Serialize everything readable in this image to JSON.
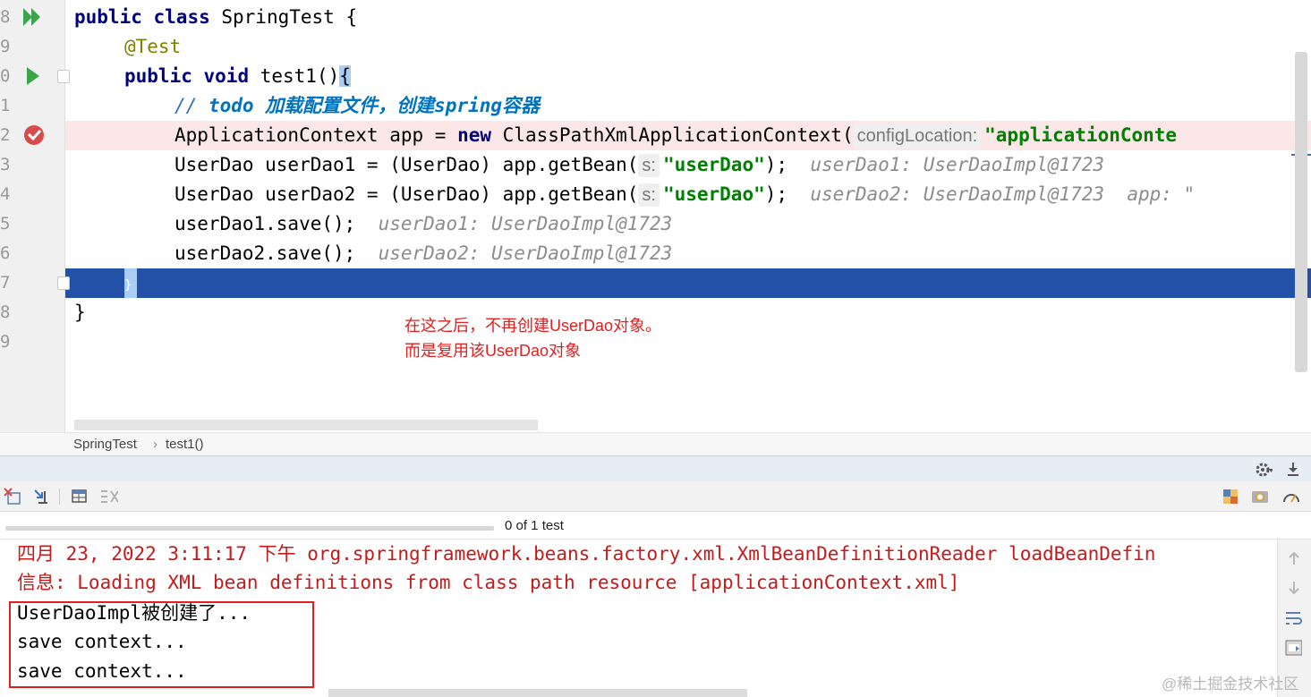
{
  "editor": {
    "line_numbers": [
      "8",
      "9",
      "0",
      "1",
      "2",
      "3",
      "4",
      "5",
      "6",
      "7",
      "8",
      "9"
    ],
    "lines": {
      "l8": {
        "kw1": "public",
        "kw2": "class",
        "rest": " SpringTest {"
      },
      "l9": {
        "annotation": "@Test"
      },
      "l10": {
        "kw1": "public",
        "kw2": "void",
        "rest": " test1()",
        "brace": "{"
      },
      "l11": {
        "comment": "// ",
        "todo": "todo 加载配置文件，创建spring容器"
      },
      "l12": {
        "code": "ApplicationContext app = ",
        "kw": "new",
        "code2": " ClassPathXmlApplicationContext(",
        "hint": "configLocation:",
        "str": "\"applicationConte"
      },
      "l13": {
        "code": "UserDao userDao1 = (UserDao) app.getBean(",
        "hint": "s:",
        "str": "\"userDao\"",
        "code2": ");",
        "inline": "  userDao1: UserDaoImpl@1723"
      },
      "l14": {
        "code": "UserDao userDao2 = (UserDao) app.getBean(",
        "hint": "s:",
        "str": "\"userDao\"",
        "code2": ");",
        "inline": "  userDao2: UserDaoImpl@1723  app: \""
      },
      "l15": {
        "code": "userDao1.save();",
        "inline": "  userDao1: UserDaoImpl@1723"
      },
      "l16": {
        "code": "userDao2.save();",
        "inline": "  userDao2: UserDaoImpl@1723"
      },
      "l17": {
        "brace": "}"
      },
      "l18": {
        "code": "}"
      }
    },
    "annotation": {
      "line1": "在这之后，不再创建UserDao对象。",
      "line2": "而是复用该UserDao对象"
    }
  },
  "breadcrumb": {
    "class": "SpringTest",
    "separator": "›",
    "method": "test1()"
  },
  "run_panel": {
    "test_count": "0 of 1 test",
    "progress": 0,
    "console_lines": [
      "四月 23, 2022 3:11:17 下午 org.springframework.beans.factory.xml.XmlBeanDefinitionReader loadBeanDefin",
      "信息: Loading XML bean definitions from class path resource [applicationContext.xml]",
      "UserDaoImpl被创建了...",
      "save context...",
      "save context..."
    ]
  },
  "watermark": "@稀土掘金技术社区",
  "colors": {
    "keyword": "#000080",
    "string": "#008000",
    "comment": "#2e6db5",
    "annotation": "#808000",
    "current_line": "#2251a7",
    "breakpoint_line": "#fbe7e7",
    "console_error": "#c41a1a",
    "highlight_box": "#e02020"
  },
  "icons": [
    "run-all-icon",
    "run-icon",
    "breakpoint-icon",
    "gear-icon",
    "download-icon",
    "rerun-failed-icon",
    "sort-icon",
    "table-icon",
    "collapse-icon",
    "layout-icon",
    "camera-icon",
    "speed-icon",
    "scroll-up-icon",
    "scroll-down-icon",
    "soft-wrap-icon",
    "print-icon"
  ]
}
